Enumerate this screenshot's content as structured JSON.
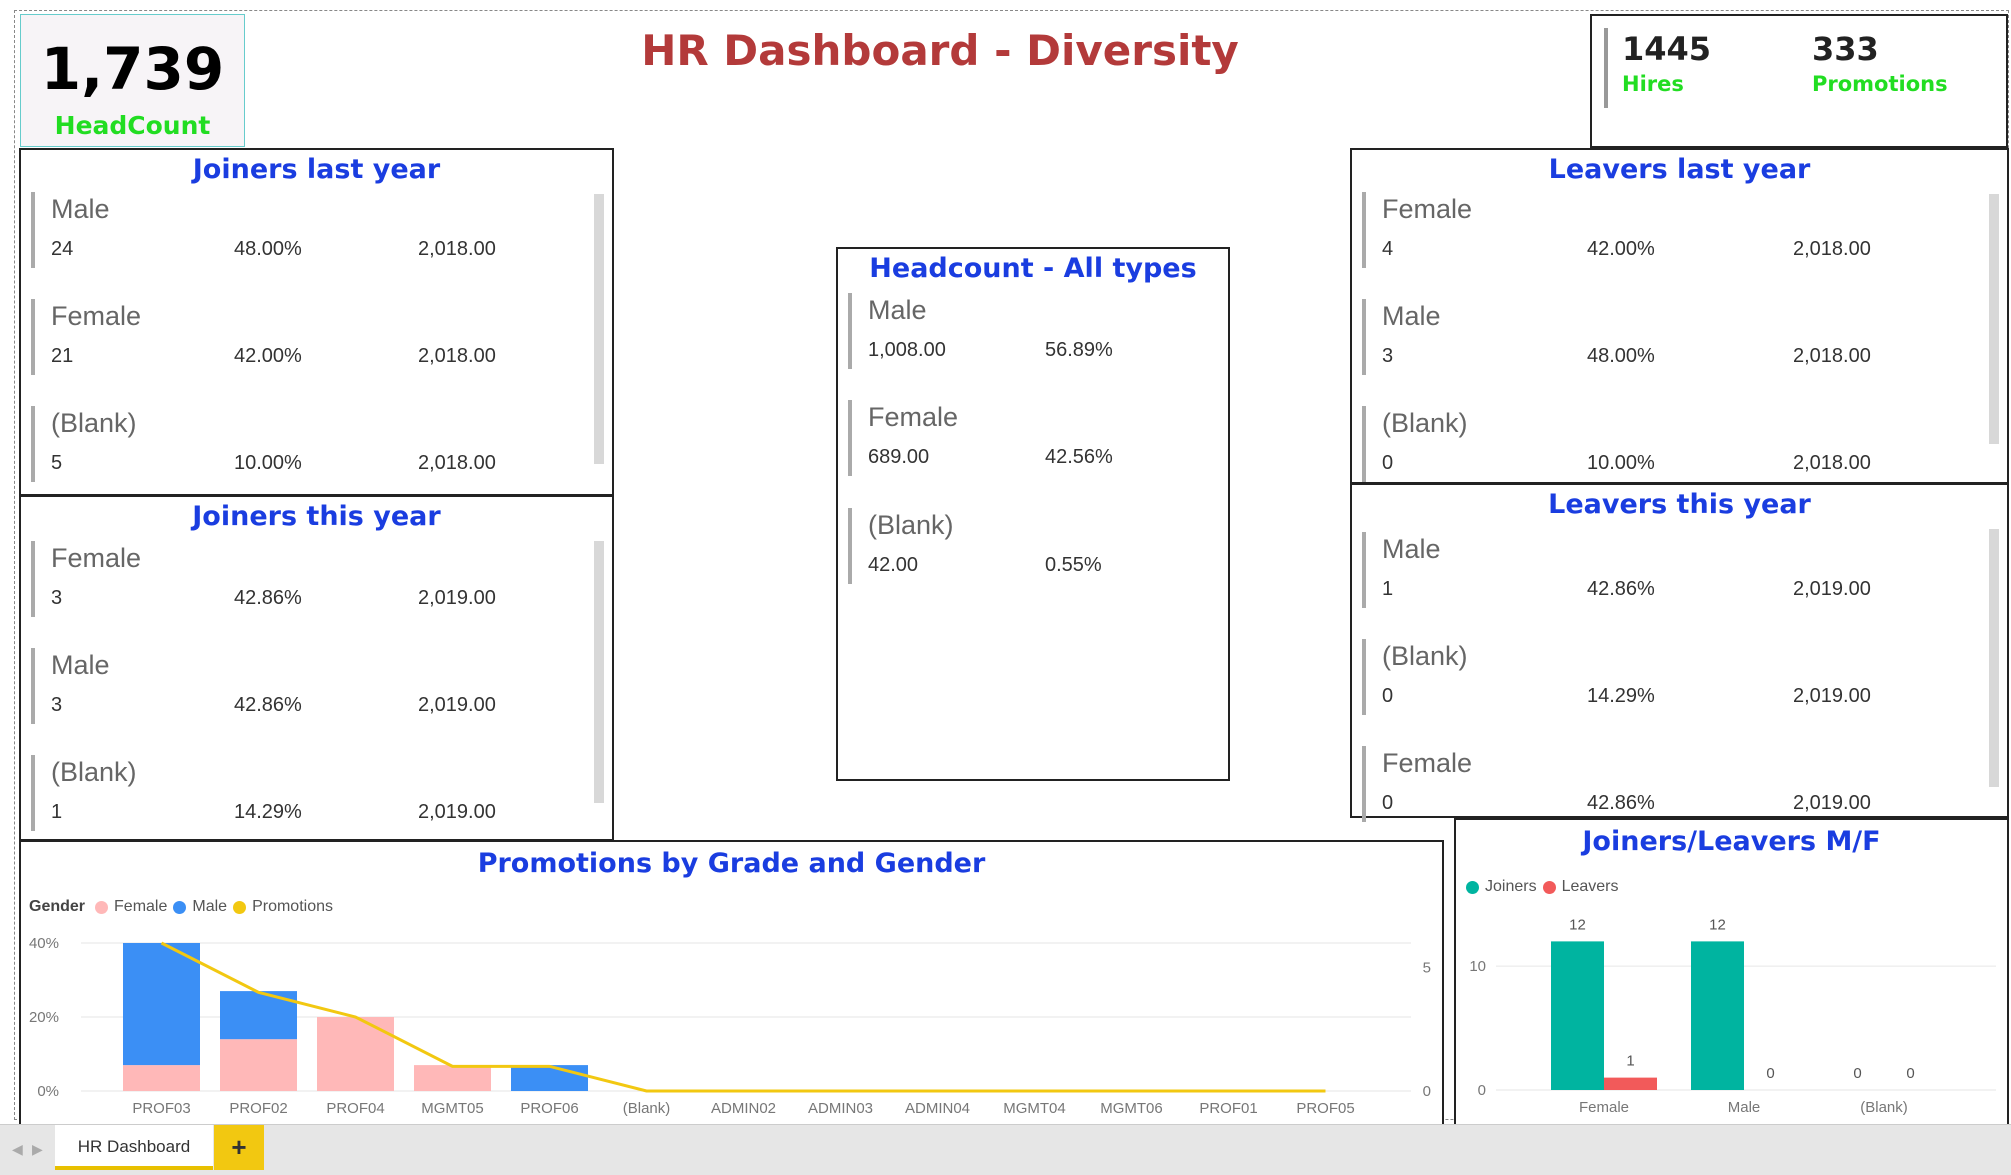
{
  "headcount": {
    "value": "1,739",
    "label": "HeadCount"
  },
  "title": "HR Dashboard - Diversity",
  "kpis": [
    {
      "value": "1445",
      "label": "Hires"
    },
    {
      "value": "333",
      "label": "Promotions"
    }
  ],
  "joiners_last_year": {
    "title": "Joiners last year",
    "rows": [
      {
        "category": "Male",
        "count": "24",
        "pct": "48.00%",
        "year": "2,018.00"
      },
      {
        "category": "Female",
        "count": "21",
        "pct": "42.00%",
        "year": "2,018.00"
      },
      {
        "category": "(Blank)",
        "count": "5",
        "pct": "10.00%",
        "year": "2,018.00"
      }
    ]
  },
  "joiners_this_year": {
    "title": "Joiners this year",
    "rows": [
      {
        "category": "Female",
        "count": "3",
        "pct": "42.86%",
        "year": "2,019.00"
      },
      {
        "category": "Male",
        "count": "3",
        "pct": "42.86%",
        "year": "2,019.00"
      },
      {
        "category": "(Blank)",
        "count": "1",
        "pct": "14.29%",
        "year": "2,019.00"
      }
    ]
  },
  "headcount_all": {
    "title": "Headcount - All types",
    "rows": [
      {
        "category": "Male",
        "count": "1,008.00",
        "pct": "56.89%"
      },
      {
        "category": "Female",
        "count": "689.00",
        "pct": "42.56%"
      },
      {
        "category": "(Blank)",
        "count": "42.00",
        "pct": "0.55%"
      }
    ]
  },
  "leavers_last_year": {
    "title": "Leavers last year",
    "rows": [
      {
        "category": "Female",
        "count": "4",
        "pct": "42.00%",
        "year": "2,018.00"
      },
      {
        "category": "Male",
        "count": "3",
        "pct": "48.00%",
        "year": "2,018.00"
      },
      {
        "category": "(Blank)",
        "count": "0",
        "pct": "10.00%",
        "year": "2,018.00"
      }
    ]
  },
  "leavers_this_year": {
    "title": "Leavers this year",
    "rows": [
      {
        "category": "Male",
        "count": "1",
        "pct": "42.86%",
        "year": "2,019.00"
      },
      {
        "category": "(Blank)",
        "count": "0",
        "pct": "14.29%",
        "year": "2,019.00"
      },
      {
        "category": "Female",
        "count": "0",
        "pct": "42.86%",
        "year": "2,019.00"
      }
    ]
  },
  "chart_data": [
    {
      "type": "bar",
      "title": "Promotions by Grade and Gender",
      "legend_title": "Gender",
      "categories": [
        "PROF03",
        "PROF02",
        "PROF04",
        "MGMT05",
        "PROF06",
        "(Blank)",
        "ADMIN02",
        "ADMIN03",
        "ADMIN04",
        "MGMT04",
        "MGMT06",
        "PROF01",
        "PROF05"
      ],
      "series": [
        {
          "name": "Female",
          "color": "#ffb8b8",
          "values": [
            7,
            14,
            20,
            7,
            0,
            0,
            0,
            0,
            0,
            0,
            0,
            0,
            0
          ]
        },
        {
          "name": "Male",
          "color": "#3b8ff5",
          "values": [
            33,
            13,
            0,
            0,
            7,
            0,
            0,
            0,
            0,
            0,
            0,
            0,
            0
          ]
        },
        {
          "name": "Promotions",
          "color": "#f2c811",
          "line": true,
          "axis": "right",
          "values": [
            6,
            4,
            3,
            1,
            1,
            0,
            0,
            0,
            0,
            0,
            0,
            0,
            0
          ]
        }
      ],
      "y_ticks": [
        "0%",
        "20%",
        "40%"
      ],
      "ylim": [
        0,
        40
      ],
      "y2_ticks": [
        "0",
        "5"
      ],
      "y2lim": [
        0,
        6
      ],
      "legend_position": "top-left"
    },
    {
      "type": "bar",
      "title": "Joiners/Leavers M/F",
      "categories": [
        "Female",
        "Male",
        "(Blank)"
      ],
      "series": [
        {
          "name": "Joiners",
          "color": "#00b4a0",
          "values": [
            12,
            12,
            0
          ]
        },
        {
          "name": "Leavers",
          "color": "#f25a5a",
          "values": [
            1,
            0,
            0
          ]
        }
      ],
      "y_ticks": [
        "0",
        "10"
      ],
      "ylim": [
        0,
        13
      ],
      "legend_position": "top-left"
    }
  ],
  "tabs": {
    "active": "HR Dashboard",
    "add": "+"
  }
}
